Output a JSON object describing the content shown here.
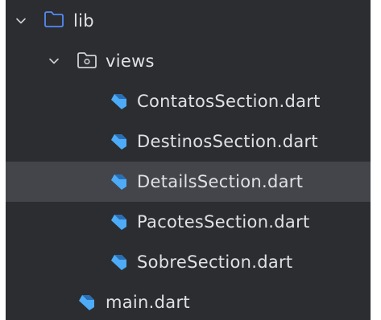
{
  "tree": {
    "root": {
      "label": "lib",
      "expanded": true,
      "icon": "folder-icon"
    },
    "views": {
      "label": "views",
      "expanded": true,
      "icon": "package-folder-icon"
    },
    "files": [
      {
        "label": "ContatosSection.dart",
        "icon": "dart-file-icon",
        "selected": false
      },
      {
        "label": "DestinosSection.dart",
        "icon": "dart-file-icon",
        "selected": false
      },
      {
        "label": "DetailsSection.dart",
        "icon": "dart-file-icon",
        "selected": true
      },
      {
        "label": "PacotesSection.dart",
        "icon": "dart-file-icon",
        "selected": false
      },
      {
        "label": "SobreSection.dart",
        "icon": "dart-file-icon",
        "selected": false
      }
    ],
    "main": {
      "label": "main.dart",
      "icon": "dart-file-icon"
    }
  },
  "colors": {
    "panel_background": "#2b2d30",
    "selection_background": "#43454a",
    "text": "#dfe1e5",
    "folder_accent": "#548af7",
    "dart_icon": "#4dabf7"
  }
}
